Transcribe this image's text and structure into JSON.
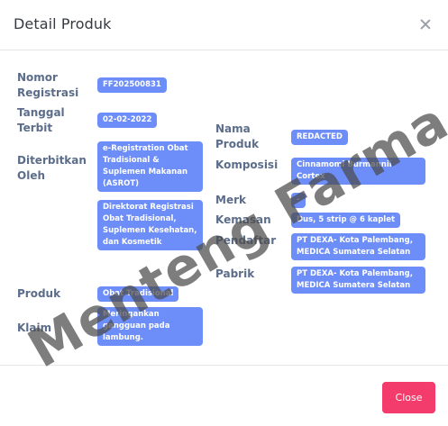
{
  "modal": {
    "title": "Detail Produk",
    "close_button_label": "Close"
  },
  "fields_left": [
    {
      "label": "Nomor\nRegistrasi",
      "value": "FF202500831"
    },
    {
      "label": "Tanggal\nTerbit",
      "value": "02-02-2022"
    },
    {
      "label": "Diterbitkan\nOleh",
      "value": "e-Registration Obat Tradisional & Suplemen Makanan (ASROT)",
      "value2": "Direktorat Registrasi Obat Tradisional, Suplemen Kesehatan, dan Kosmetik"
    },
    {
      "label": "Produk",
      "value": "Obat Tradisional"
    },
    {
      "label": "Klaim",
      "value": "Meringankan gangguan pada lambung."
    }
  ],
  "fields_right": [
    {
      "label": "Nama\nProduk",
      "value": "REDACTED"
    },
    {
      "label": "Komposisi",
      "value": "Cinnamomi Burmannii Cortex"
    },
    {
      "label": "Merk",
      "value": "-"
    },
    {
      "label": "Kemasan",
      "value": "Dus, 5 strip @ 6 kaplet"
    },
    {
      "label": "Pendaftar",
      "value": "PT DEXA- Kota Palembang, MEDICA Sumatera Selatan"
    },
    {
      "label": "Pabrik",
      "value": "PT DEXA- Kota Palembang, MEDICA Sumatera Selatan"
    }
  ],
  "watermark": {
    "text": "Menteng Farma"
  },
  "colors": {
    "badge": "#6d8ef8",
    "label": "#5b6d8a",
    "close_button": "#f33b6c"
  }
}
